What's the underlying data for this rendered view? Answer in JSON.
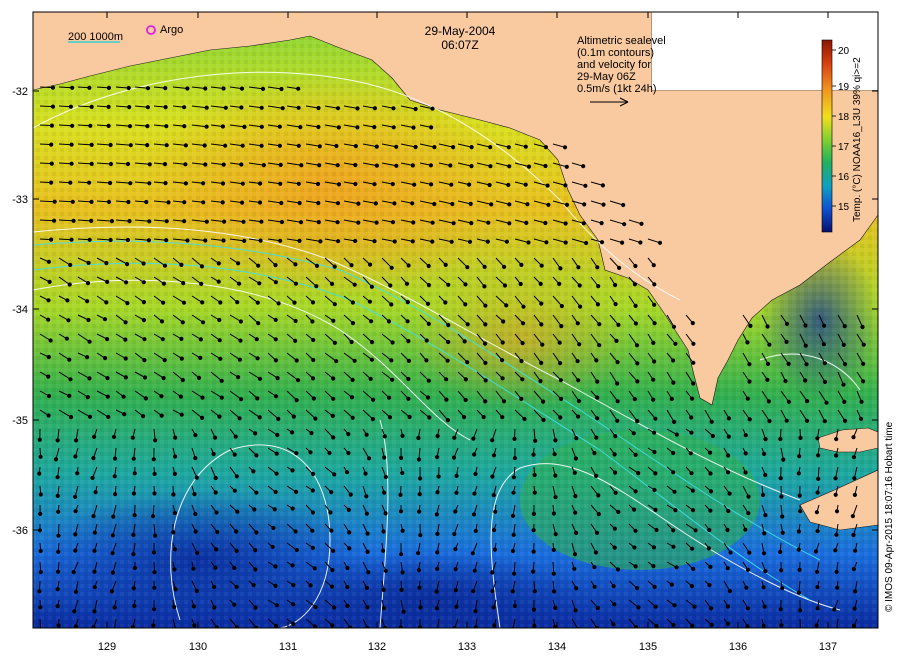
{
  "map": {
    "date": "29-May-2004",
    "time": "06:07Z",
    "scale_note": "200  1000m",
    "argo_label": "Argo",
    "info_lines": [
      "Altimetric sealevel",
      "(0.1m contours)",
      "and velocity for",
      "29-May 06Z",
      "0.5m/s (1kt 24h)"
    ],
    "credit": "© IMOS 09-Apr-2015 18:07:16 Hobart time",
    "lon_ticks": [
      "129",
      "130",
      "131",
      "132",
      "133",
      "134",
      "135",
      "136",
      "137"
    ],
    "lat_ticks": [
      "-32",
      "-33",
      "-34",
      "-35",
      "-36"
    ],
    "colors": {
      "land": "#f9c9a0",
      "sea_warm": "#e8b020",
      "sea_mid": "#39b54a",
      "sea_cool": "#1a6ddd"
    }
  },
  "colorbar": {
    "title": "Temp. (°C) NOAA16_L3U 39% qi>=2",
    "ticks": [
      "20",
      "19",
      "18",
      "17",
      "16",
      "15"
    ],
    "stops": [
      "#8a1600",
      "#d64010",
      "#f09020",
      "#f0e020",
      "#80d030",
      "#20b060",
      "#10a0c0",
      "#1050d0",
      "#081070"
    ]
  }
}
